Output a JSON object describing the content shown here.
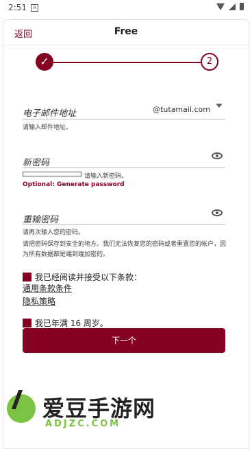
{
  "status_bar": {
    "time": "2:51",
    "notification_badge": "A",
    "icons": [
      "wifi-icon",
      "signal-icon",
      "battery-icon"
    ]
  },
  "header": {
    "back_label": "返回",
    "title": "Free"
  },
  "stepper": {
    "completed_step_icon": "checkmark-icon",
    "current_step": "2"
  },
  "email": {
    "label": "电子邮件地址",
    "domain_suffix": "@tutamail.com",
    "help": "请输入邮件地址。"
  },
  "new_password": {
    "label": "新密码",
    "strength_hint": "请输入新密码。",
    "generate_link": "Optional: Generate password"
  },
  "repeat_password": {
    "label": "重输密码",
    "help": "请再次输入您的密码。"
  },
  "notice": "请把密码保存到安全的地方。我们无法恢复您的密码或者重置您的帐户，因为所有数据都是端到端加密的。",
  "terms": {
    "label": "我已经阅读并接受以下条款：",
    "link_terms": "通用条款条件",
    "link_privacy": "隐私策略"
  },
  "age": {
    "label": "我已年满 16 周岁。"
  },
  "next_button": "下一个",
  "watermark": {
    "title": "爱豆手游网",
    "subtitle": "ADJZC.COM"
  },
  "colors": {
    "accent": "#850122",
    "watermark_green": "#7cc243"
  }
}
